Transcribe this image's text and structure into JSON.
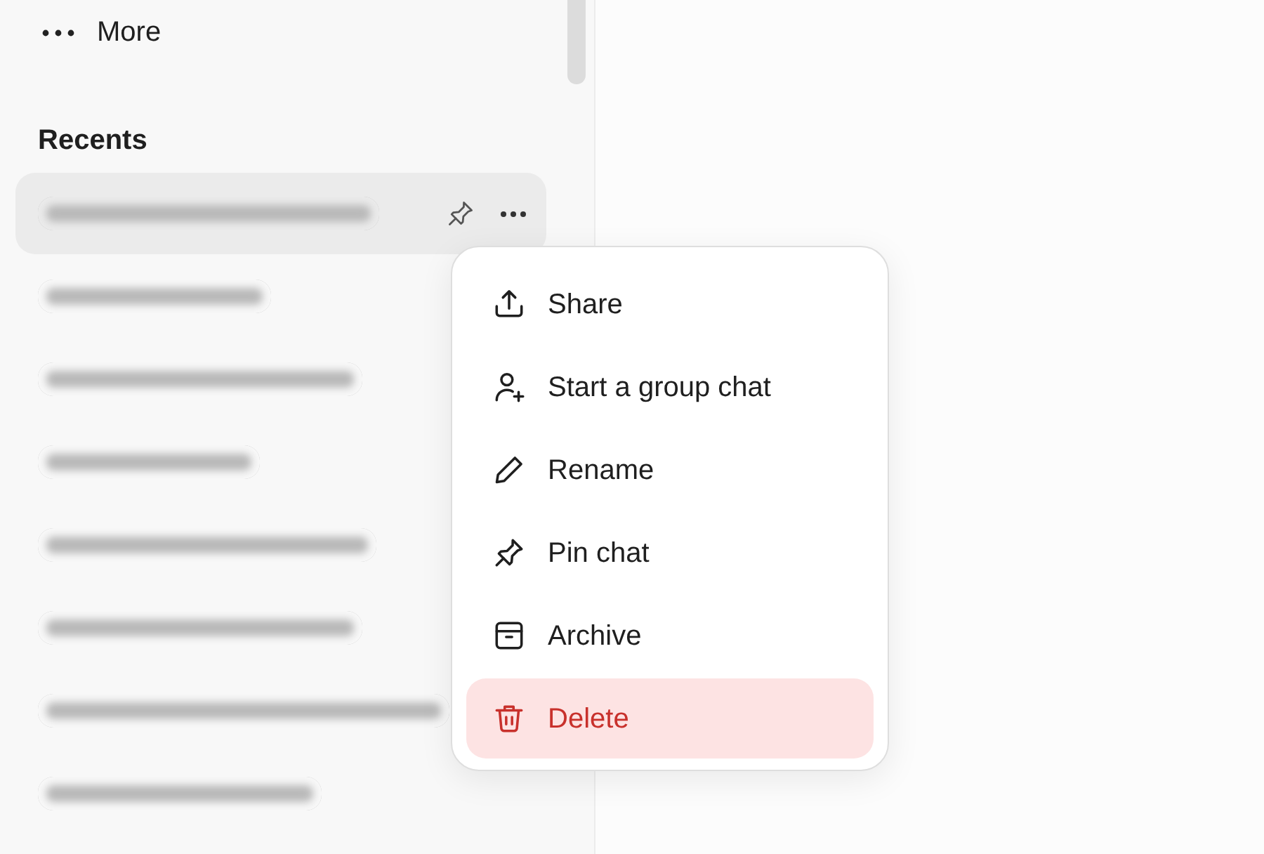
{
  "sidebar": {
    "more_item": {
      "label": "More"
    },
    "section_title": "Recents",
    "recents": [
      {
        "selected": true
      },
      {
        "selected": false
      },
      {
        "selected": false
      },
      {
        "selected": false
      },
      {
        "selected": false
      },
      {
        "selected": false
      },
      {
        "selected": false
      },
      {
        "selected": false
      }
    ]
  },
  "context_menu": {
    "items": [
      {
        "label": "Share",
        "kind": "normal",
        "selected": false
      },
      {
        "label": "Start a group chat",
        "kind": "normal",
        "selected": false
      },
      {
        "label": "Rename",
        "kind": "normal",
        "selected": false
      },
      {
        "label": "Pin chat",
        "kind": "normal",
        "selected": false
      },
      {
        "label": "Archive",
        "kind": "normal",
        "selected": false
      },
      {
        "label": "Delete",
        "kind": "danger",
        "selected": true
      }
    ]
  }
}
